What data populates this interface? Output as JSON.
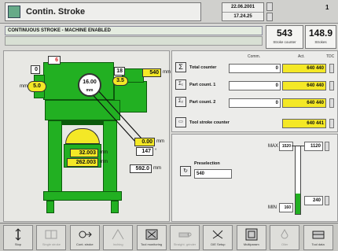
{
  "header": {
    "title": "Contin. Stroke",
    "date": "22.06.2001",
    "time": "17.24.25",
    "page_number": "1"
  },
  "message_bar": {
    "text": "CONTINUOUS STROKE - MACHINE ENABLED"
  },
  "counters": [
    {
      "value": "543",
      "label": "Stroke counter"
    },
    {
      "value": "148.9",
      "label": "Strokes"
    }
  ],
  "machine": {
    "top_red_value": "6",
    "left_small_value": "0",
    "speed_value": "5.0",
    "speed_unit": "mm",
    "dial_value": "16.00",
    "dial_unit": "mm",
    "small_white_value": "18",
    "oval_value": "3.5",
    "yellow_top_right": "540",
    "yellow_top_right_unit": "mm",
    "right_mid_value": "0.00",
    "right_mid_unit": "mm",
    "right_small_value": "147",
    "right_small_unit": "°",
    "table_value_1": "32.003",
    "table_value_1_unit": "mm",
    "table_value_2": "262.003",
    "table_value_2_unit": "mm",
    "bottom_value": "592.0",
    "bottom_unit": "mm"
  },
  "counter_table": {
    "col_headers": [
      "Comm.",
      "Act.",
      "TDC"
    ],
    "rows": [
      {
        "label": "Total counter",
        "comm": "0",
        "act": "640 440"
      },
      {
        "label": "Part count. 1",
        "comm": "0",
        "act": "640 440"
      },
      {
        "label": "Part count. 2",
        "comm": "0",
        "act": "640 440"
      }
    ],
    "total_stroke": {
      "label": "Tool stroke counter",
      "act": "640 441"
    }
  },
  "preselection": {
    "label": "Preselection",
    "value": "540",
    "max_label": "MAX",
    "max_value": "1520",
    "upper_value": "1120",
    "min_label": "MIN",
    "min_value": "160",
    "lower_value": "240",
    "level_fraction": 0.3
  },
  "toolbar": [
    {
      "label": "Stop",
      "icon": "stop-icon",
      "dim": false
    },
    {
      "label": "Single stroke",
      "icon": "single-stroke-icon",
      "dim": true
    },
    {
      "label": "Cont. stroke",
      "icon": "cont-stroke-icon",
      "dim": false
    },
    {
      "label": "Inching",
      "icon": "inching-icon",
      "dim": true
    },
    {
      "label": "Tool monitoring",
      "icon": "tool-monitor-icon",
      "dim": false
    },
    {
      "label": "Straight. grinder",
      "icon": "grinder-icon",
      "dim": true
    },
    {
      "label": "DIE Setup",
      "icon": "die-setup-icon",
      "dim": false
    },
    {
      "label": "Multiparam",
      "icon": "multiparam-icon",
      "dim": false
    },
    {
      "label": "Oiler",
      "icon": "oiler-icon",
      "dim": true
    },
    {
      "label": "Tool data",
      "icon": "tool-data-icon",
      "dim": false
    }
  ],
  "colors": {
    "machine_green": "#22b022",
    "highlight_yellow": "#f4e826",
    "alert_red": "#d42020"
  }
}
